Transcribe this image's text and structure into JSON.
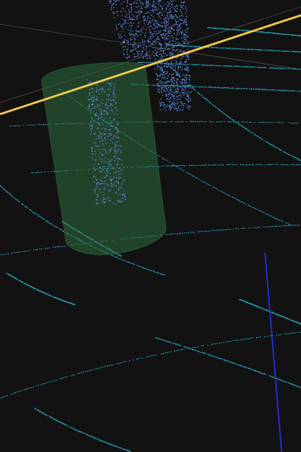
{
  "viewer": {
    "background_color": "#121212",
    "colors": {
      "ground_points": "#2aa3b8",
      "object_points": "#5d86e0",
      "bbox_fill": "#2e6b3c",
      "bbox_edge": "#3f8a52",
      "trajectory_line": "#f2c94c",
      "axis_line": "#1f2fd6",
      "grid_line": "#6a6a6a"
    },
    "icons": [
      "point-cloud-icon",
      "bounding-cylinder-icon"
    ]
  }
}
